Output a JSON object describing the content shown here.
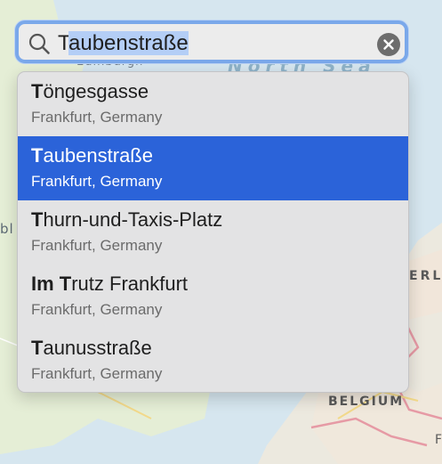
{
  "map": {
    "labels": {
      "sea": "North Sea",
      "city": "Edinburgh",
      "west": "bl",
      "netherlands": "ERLA",
      "belgium": "BELGIUM",
      "edge": "F"
    }
  },
  "search": {
    "prefix": "T",
    "selected_suffix": "aubenstraße"
  },
  "suggestions": [
    {
      "bold": "T",
      "rest": "öngesgasse",
      "subtitle": "Frankfurt, Germany",
      "selected": false
    },
    {
      "bold": "T",
      "rest": "aubenstraße",
      "subtitle": "Frankfurt, Germany",
      "selected": true
    },
    {
      "bold": "T",
      "rest": "hurn-und-Taxis-Platz",
      "subtitle": "Frankfurt, Germany",
      "selected": false
    },
    {
      "bold": "Im T",
      "rest": "rutz Frankfurt",
      "subtitle": "Frankfurt, Germany",
      "selected": false
    },
    {
      "bold": "T",
      "rest": "aunusstraße",
      "subtitle": "Frankfurt, Germany",
      "selected": false
    }
  ],
  "colors": {
    "selection_blue": "#2b63d9",
    "focus_ring": "#7aa8ea",
    "sea": "#d7e7f0",
    "land": "#e6efd8"
  }
}
